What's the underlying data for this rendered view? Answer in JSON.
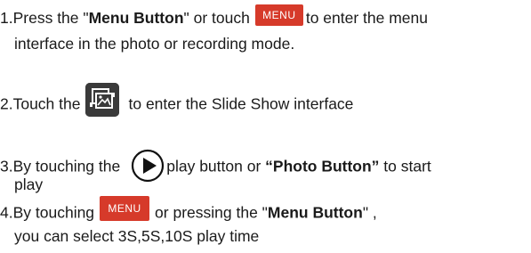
{
  "steps": [
    {
      "line1_before": "1.Press the \"",
      "line1_bold": "Menu Button",
      "line1_mid": "\" or touch",
      "menu_label": "MENU",
      "line1_after": "to enter the menu",
      "line2": "interface in the photo or recording mode."
    },
    {
      "before": "2.Touch the",
      "icon": "slideshow-icon",
      "after": "to enter the Slide Show interface"
    },
    {
      "line1_before": "3.By touching the",
      "icon": "play-icon",
      "line1_mid": "play button or ",
      "line1_bold": "“Photo Button”",
      "line1_after": " to start",
      "line2": "play"
    },
    {
      "line1_before": "4.By touching",
      "menu_label": "MENU",
      "line1_mid": "or pressing the \"",
      "line1_bold": "Menu Button",
      "line1_after": "\" ,",
      "line2": "you can select 3S,5S,10S play time"
    }
  ],
  "colors": {
    "menu_button_bg": "#d63a2a",
    "slide_icon_bg": "#3a3a3a",
    "text": "#1a1a1a"
  }
}
